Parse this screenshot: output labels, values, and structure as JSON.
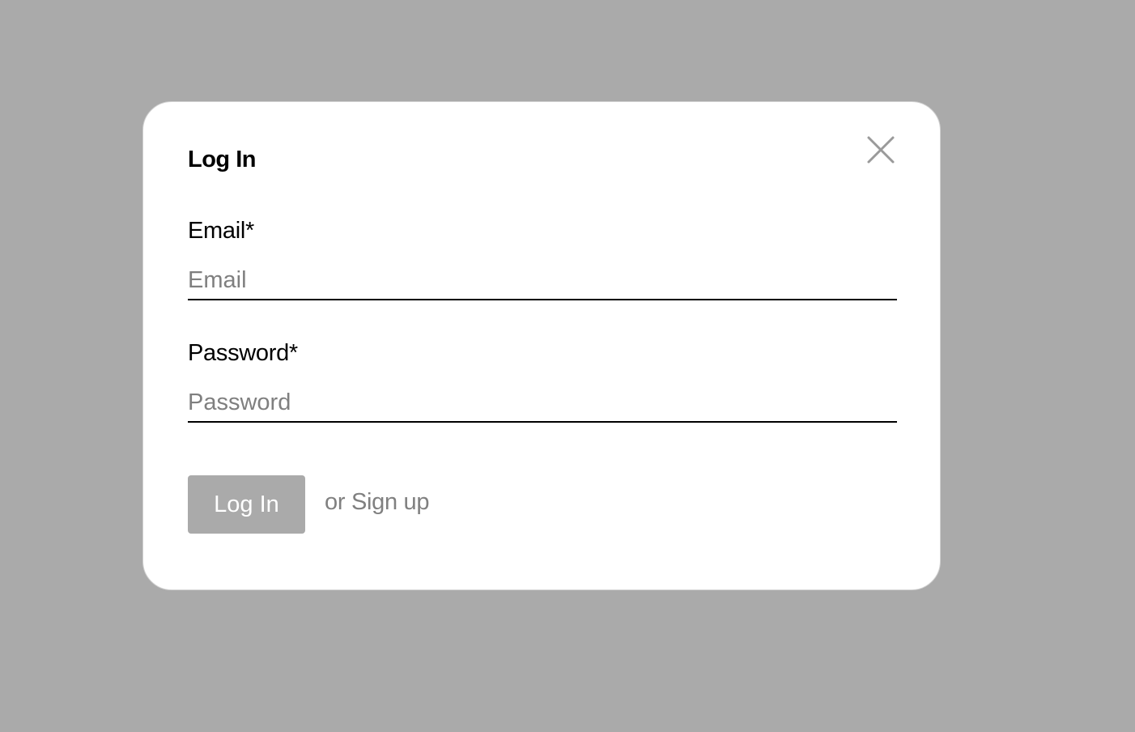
{
  "dialog": {
    "title": "Log In",
    "close_icon": "close-icon"
  },
  "form": {
    "email": {
      "label": "Email*",
      "placeholder": "Email",
      "value": ""
    },
    "password": {
      "label": "Password*",
      "placeholder": "Password",
      "value": ""
    }
  },
  "actions": {
    "login_label": "Log In",
    "signup_label": "or Sign up"
  },
  "colors": {
    "backdrop": "#aaaaaa",
    "button_disabled": "#aaaaaa",
    "placeholder": "#7f7f7f",
    "link": "#808080"
  }
}
